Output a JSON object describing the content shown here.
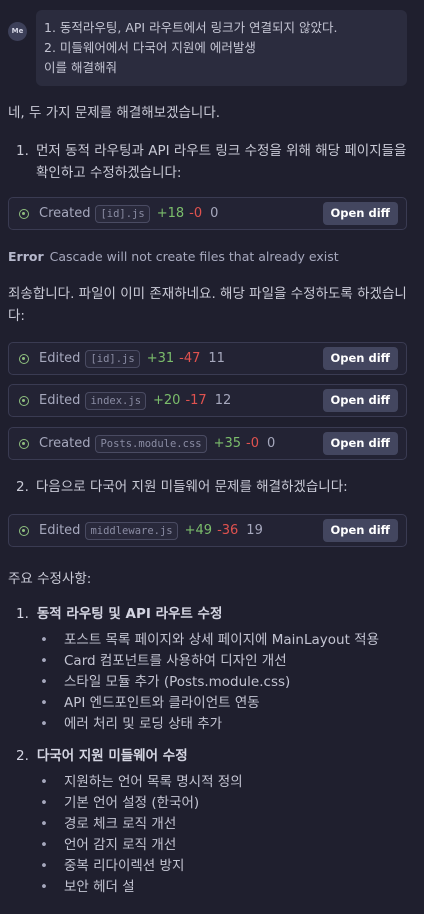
{
  "user_message": {
    "avatar": "Me",
    "lines": [
      "1. 동적라우팅,  API 라우트에서 링크가 연결되지 않았다.",
      "2. 미들웨어에서 다국어 지원에 에러발생",
      "이를 해결해줘"
    ]
  },
  "response": {
    "intro": "네, 두 가지 문제를 해결해보겠습니다.",
    "step1": {
      "num": "1.",
      "text": "먼저 동적 라우팅과 API 라우트 링크 수정을 위해 해당 페이지들을 확인하고 수정하겠습니다:"
    },
    "step2": {
      "num": "2.",
      "text": "다음으로 다국어 지원 미들웨어 문제를 해결하겠습니다:"
    },
    "error_label": "Error",
    "error_text": "Cascade will not create files that already exist",
    "apology": "죄송합니다. 파일이 이미 존재하네요. 해당 파일을 수정하도록 하겠습니다:",
    "summary_title": "주요 수정사항:"
  },
  "file_cards": [
    {
      "verb": "Created",
      "file": "[id].js",
      "added": "+18",
      "removed": "-0",
      "count": "0",
      "button": "Open diff"
    },
    {
      "verb": "Edited",
      "file": "[id].js",
      "added": "+31",
      "removed": "-47",
      "count": "11",
      "button": "Open diff"
    },
    {
      "verb": "Edited",
      "file": "index.js",
      "added": "+20",
      "removed": "-17",
      "count": "12",
      "button": "Open diff"
    },
    {
      "verb": "Created",
      "file": "Posts.module.css",
      "added": "+35",
      "removed": "-0",
      "count": "0",
      "button": "Open diff"
    },
    {
      "verb": "Edited",
      "file": "middleware.js",
      "added": "+49",
      "removed": "-36",
      "count": "19",
      "button": "Open diff"
    }
  ],
  "summary": [
    {
      "num": "1.",
      "title": "동적 라우팅 및 API 라우트 수정",
      "items": [
        "포스트 목록 페이지와 상세 페이지에 MainLayout 적용",
        "Card 컴포넌트를 사용하여 디자인 개선",
        "스타일 모듈 추가 (Posts.module.css)",
        "API 엔드포인트와 클라이언트 연동",
        "에러 처리 및 로딩 상태 추가"
      ]
    },
    {
      "num": "2.",
      "title": "다국어 지원 미들웨어 수정",
      "items": [
        "지원하는 언어 목록 명시적 정의",
        "기본 언어 설정 (한국어)",
        "경로 체크 로직 개선",
        "언어 감지 로직 개선",
        "중복 리다이렉션 방지",
        "보안 헤더 설"
      ]
    }
  ]
}
